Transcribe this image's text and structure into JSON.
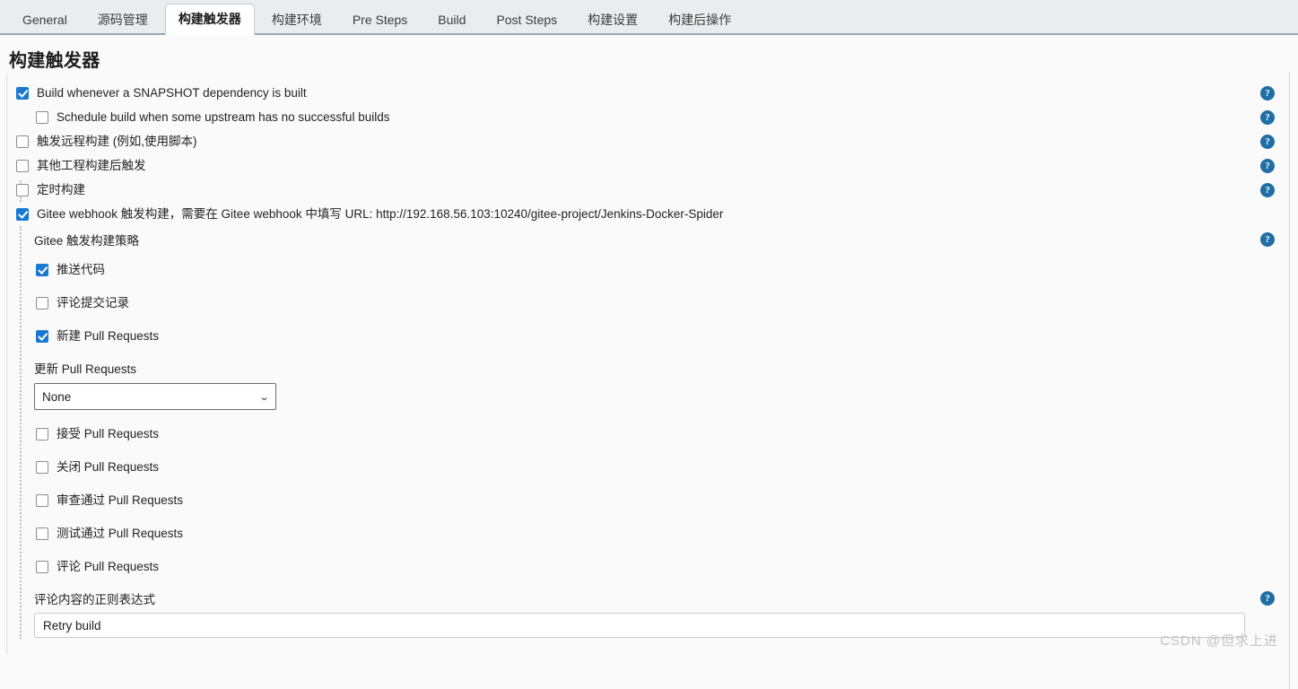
{
  "tabs": [
    {
      "label": "General",
      "active": false
    },
    {
      "label": "源码管理",
      "active": false
    },
    {
      "label": "构建触发器",
      "active": true
    },
    {
      "label": "构建环境",
      "active": false
    },
    {
      "label": "Pre Steps",
      "active": false
    },
    {
      "label": "Build",
      "active": false
    },
    {
      "label": "Post Steps",
      "active": false
    },
    {
      "label": "构建设置",
      "active": false
    },
    {
      "label": "构建后操作",
      "active": false
    }
  ],
  "page": {
    "title": "构建触发器"
  },
  "triggers": [
    {
      "label": "Build whenever a SNAPSHOT dependency is built",
      "checked": true
    },
    {
      "label": "Schedule build when some upstream has no successful builds",
      "checked": false
    },
    {
      "label": "触发远程构建 (例如,使用脚本)",
      "checked": false
    },
    {
      "label": "其他工程构建后触发",
      "checked": false
    },
    {
      "label": "定时构建",
      "checked": false
    }
  ],
  "gitee": {
    "main_label": "Gitee webhook 触发构建，需要在 Gitee webhook 中填写 URL: http://192.168.56.103:10240/gitee-project/Jenkins-Docker-Spider",
    "main_checked": true,
    "section_label": "Gitee 触发构建策略",
    "events_top": [
      {
        "label": "推送代码",
        "checked": true
      },
      {
        "label": "评论提交记录",
        "checked": false
      },
      {
        "label": "新建 Pull Requests",
        "checked": true
      }
    ],
    "update_pr_label": "更新 Pull Requests",
    "update_pr_value": "None",
    "events_bottom": [
      {
        "label": "接受 Pull Requests",
        "checked": false
      },
      {
        "label": "关闭 Pull Requests",
        "checked": false
      },
      {
        "label": "审查通过 Pull Requests",
        "checked": false
      },
      {
        "label": "测试通过 Pull Requests",
        "checked": false
      },
      {
        "label": "评论 Pull Requests",
        "checked": false
      }
    ],
    "regex_label": "评论内容的正则表达式",
    "regex_value": "Retry build"
  },
  "help_icon_char": "?",
  "chevron_char": "⌄",
  "watermark": "CSDN @但求上进",
  "colors": {
    "accent": "#1878d2",
    "help": "#1f6fa5",
    "tabbar_bg": "#e9edf0",
    "page_bg": "#fafafa"
  }
}
